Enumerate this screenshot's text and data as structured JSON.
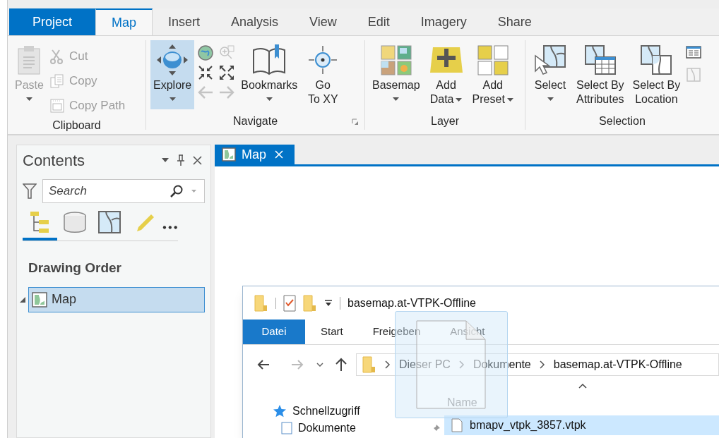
{
  "ribbon": {
    "tabs": [
      {
        "label": "Project",
        "kind": "backstage",
        "selected": false
      },
      {
        "label": "Map",
        "kind": "tab",
        "selected": true
      },
      {
        "label": "Insert",
        "kind": "tab",
        "selected": false
      },
      {
        "label": "Analysis",
        "kind": "tab",
        "selected": false
      },
      {
        "label": "View",
        "kind": "tab",
        "selected": false
      },
      {
        "label": "Edit",
        "kind": "tab",
        "selected": false
      },
      {
        "label": "Imagery",
        "kind": "tab",
        "selected": false
      },
      {
        "label": "Share",
        "kind": "tab",
        "selected": false
      }
    ],
    "groups": [
      {
        "label": "Clipboard",
        "large": [
          {
            "lines": [
              "Paste"
            ],
            "dropdown": true,
            "disabled": true,
            "selected": false
          }
        ],
        "small": [
          {
            "label": "Cut",
            "disabled": true
          },
          {
            "label": "Copy",
            "disabled": true
          },
          {
            "label": "Copy Path",
            "disabled": true
          }
        ]
      },
      {
        "label": "Navigate",
        "launcher": true,
        "large": [
          {
            "lines": [
              "Explore"
            ],
            "dropdown": true,
            "disabled": false,
            "selected": true
          },
          {
            "lines": [
              "Bookmarks"
            ],
            "dropdown": true,
            "disabled": false,
            "selected": false
          },
          {
            "lines": [
              "Go",
              "To XY"
            ],
            "disabled": false,
            "selected": false
          }
        ],
        "tools": [
          {
            "disabled": false
          },
          {
            "disabled": true
          },
          {
            "disabled": false
          },
          {
            "disabled": false
          },
          {
            "disabled": true
          },
          {
            "disabled": true
          }
        ]
      },
      {
        "label": "Layer",
        "large": [
          {
            "lines": [
              "Basemap"
            ],
            "dropdown": true,
            "disabled": false,
            "selected": false
          },
          {
            "lines": [
              "Add",
              "Data"
            ],
            "dropdown": true,
            "disabled": false,
            "selected": false
          },
          {
            "lines": [
              "Add",
              "Preset"
            ],
            "dropdown": true,
            "disabled": false,
            "selected": false
          }
        ]
      },
      {
        "label": "Selection",
        "large": [
          {
            "lines": [
              "Select"
            ],
            "dropdown": true,
            "disabled": false,
            "selected": false
          },
          {
            "lines": [
              "Select By",
              "Attributes"
            ],
            "disabled": false,
            "selected": false
          },
          {
            "lines": [
              "Select By",
              "Location"
            ],
            "disabled": false,
            "selected": false
          }
        ],
        "tools": [
          {
            "disabled": false
          },
          {
            "disabled": true
          }
        ]
      }
    ]
  },
  "contents": {
    "title": "Contents",
    "search": {
      "placeholder": "Search"
    },
    "view_tabs": [
      {
        "selected": true
      },
      {
        "selected": false
      },
      {
        "selected": false
      },
      {
        "selected": false
      }
    ],
    "heading": "Drawing Order",
    "tree": [
      {
        "label": "Map",
        "expanded": true,
        "selected": true
      }
    ]
  },
  "map_tab": {
    "label": "Map",
    "selected": true
  },
  "explorer": {
    "title": "basemap.at-VTPK-Offline",
    "tabs": [
      {
        "label": "Datei",
        "kind": "file"
      },
      {
        "label": "Start",
        "kind": "tab"
      },
      {
        "label": "Freigeben",
        "kind": "tab"
      },
      {
        "label": "Ansicht",
        "kind": "tab"
      }
    ],
    "path": [
      "Dieser PC",
      "Dokumente",
      "basemap.at-VTPK-Offline"
    ],
    "column": "Name",
    "nav": [
      {
        "label": "Schnellzugriff",
        "pinned": false
      },
      {
        "label": "Dokumente",
        "pinned": true
      }
    ],
    "files": [
      {
        "name": "bmapv_vtpk_3857.vtpk",
        "selected": true
      }
    ]
  }
}
